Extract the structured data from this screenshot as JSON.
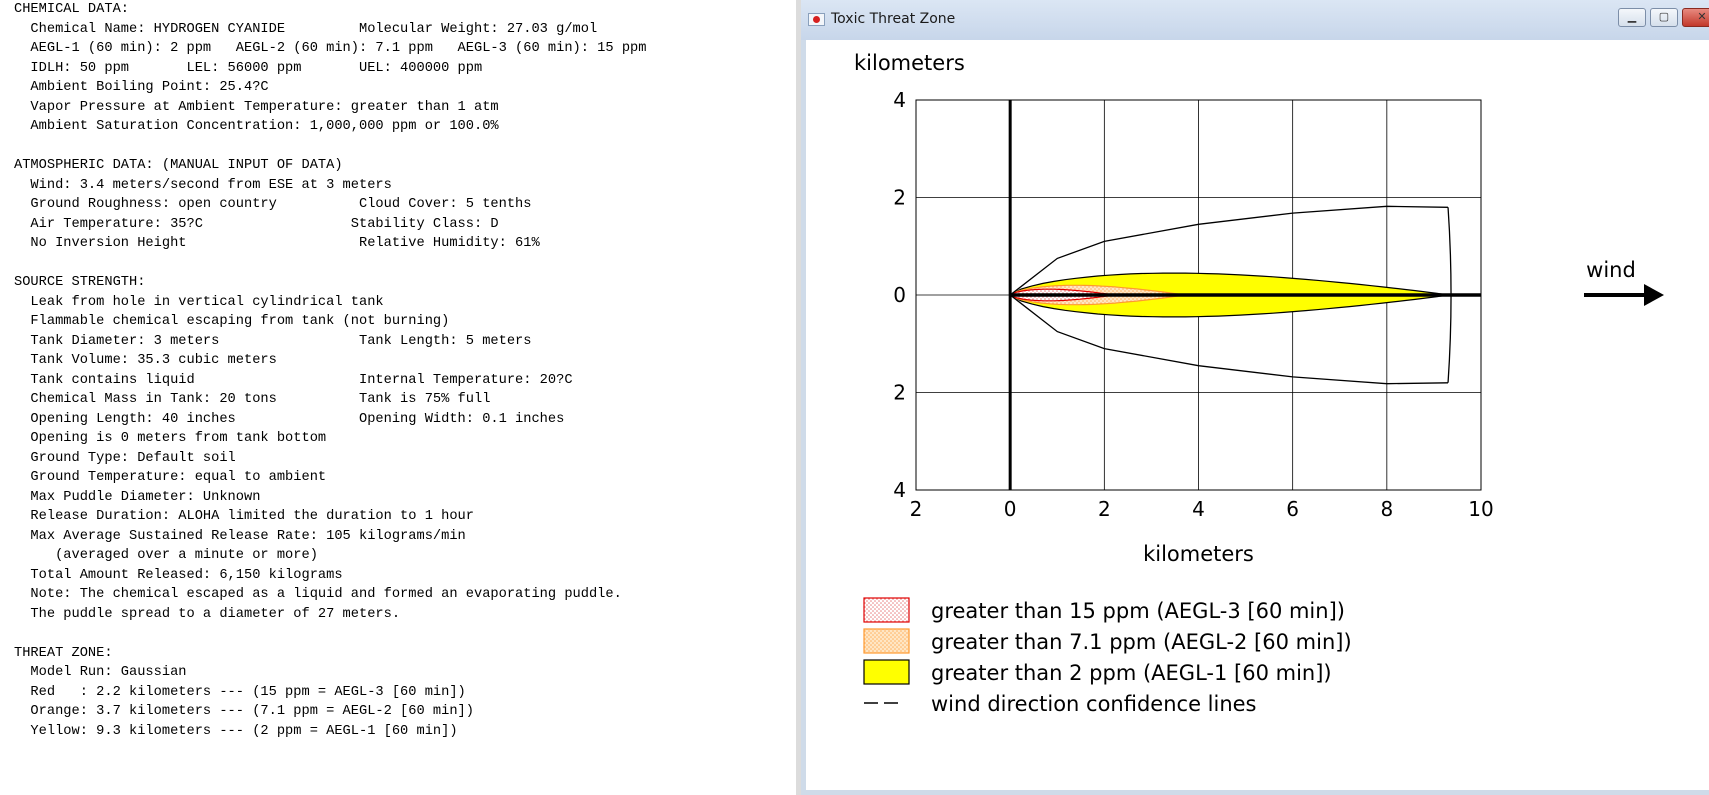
{
  "report": {
    "lines": [
      "CHEMICAL DATA:",
      "  Chemical Name: HYDROGEN CYANIDE         Molecular Weight: 27.03 g/mol",
      "  AEGL-1 (60 min): 2 ppm   AEGL-2 (60 min): 7.1 ppm   AEGL-3 (60 min): 15 ppm",
      "  IDLH: 50 ppm       LEL: 56000 ppm       UEL: 400000 ppm",
      "  Ambient Boiling Point: 25.4?C",
      "  Vapor Pressure at Ambient Temperature: greater than 1 atm",
      "  Ambient Saturation Concentration: 1,000,000 ppm or 100.0%",
      "",
      "ATMOSPHERIC DATA: (MANUAL INPUT OF DATA)",
      "  Wind: 3.4 meters/second from ESE at 3 meters",
      "  Ground Roughness: open country          Cloud Cover: 5 tenths",
      "  Air Temperature: 35?C                  Stability Class: D",
      "  No Inversion Height                     Relative Humidity: 61%",
      "",
      "SOURCE STRENGTH:",
      "  Leak from hole in vertical cylindrical tank",
      "  Flammable chemical escaping from tank (not burning)",
      "  Tank Diameter: 3 meters                 Tank Length: 5 meters",
      "  Tank Volume: 35.3 cubic meters",
      "  Tank contains liquid                    Internal Temperature: 20?C",
      "  Chemical Mass in Tank: 20 tons          Tank is 75% full",
      "  Opening Length: 40 inches               Opening Width: 0.1 inches",
      "  Opening is 0 meters from tank bottom",
      "  Ground Type: Default soil",
      "  Ground Temperature: equal to ambient",
      "  Max Puddle Diameter: Unknown",
      "  Release Duration: ALOHA limited the duration to 1 hour",
      "  Max Average Sustained Release Rate: 105 kilograms/min",
      "     (averaged over a minute or more)",
      "  Total Amount Released: 6,150 kilograms",
      "  Note: The chemical escaped as a liquid and formed an evaporating puddle.",
      "  The puddle spread to a diameter of 27 meters.",
      "",
      "THREAT ZONE:",
      "  Model Run: Gaussian",
      "  Red   : 2.2 kilometers --- (15 ppm = AEGL-3 [60 min])",
      "  Orange: 3.7 kilometers --- (7.1 ppm = AEGL-2 [60 min])",
      "  Yellow: 9.3 kilometers --- (2 ppm = AEGL-1 [60 min])"
    ]
  },
  "window": {
    "title": "Toxic Threat Zone",
    "icon": "aloha-app-icon",
    "controls": [
      "minimize",
      "maximize",
      "close"
    ]
  },
  "chart_data": {
    "type": "area",
    "ylabel": "kilometers",
    "xlabel": "kilometers",
    "xlim": [
      -2,
      10
    ],
    "ylim": [
      -4,
      4
    ],
    "x_tick_labels": [
      "2",
      "0",
      "2",
      "4",
      "6",
      "8",
      "10"
    ],
    "y_tick_labels": [
      "4",
      "2",
      "0",
      "2",
      "4"
    ],
    "grid": true,
    "wind_label": "wind",
    "zones": [
      {
        "name": "Yellow",
        "threshold": "2 ppm",
        "distance_km": 9.3,
        "max_half_width_km": 0.45,
        "color": "#ffff00",
        "edge": "#000000",
        "hatched": false
      },
      {
        "name": "Orange",
        "threshold": "7.1 ppm",
        "distance_km": 3.7,
        "max_half_width_km": 0.2,
        "color": "#ffd9a8",
        "edge": "#ff9a30",
        "hatched": true
      },
      {
        "name": "Red",
        "threshold": "15 ppm",
        "distance_km": 2.2,
        "max_half_width_km": 0.12,
        "color": "#ffd0d0",
        "edge": "#e00000",
        "hatched": true
      }
    ],
    "confidence_lines": {
      "points": [
        [
          0,
          0
        ],
        [
          1,
          0.75
        ],
        [
          2,
          1.1
        ],
        [
          4,
          1.45
        ],
        [
          6,
          1.68
        ],
        [
          8,
          1.82
        ],
        [
          9.3,
          1.8
        ]
      ],
      "tip_x": 9.3
    },
    "legend": [
      {
        "label": "greater than 15 ppm (AEGL-3 [60 min])",
        "color": "#ffd0d0",
        "edge": "#e00000",
        "type": "hatch"
      },
      {
        "label": "greater than 7.1 ppm (AEGL-2 [60 min])",
        "color": "#ffd9a8",
        "edge": "#ff9a30",
        "type": "hatch"
      },
      {
        "label": "greater than 2 ppm (AEGL-1 [60 min])",
        "color": "#ffff00",
        "edge": "#000000",
        "type": "solid"
      },
      {
        "label": "wind direction confidence lines",
        "color": "#000000",
        "edge": "#000000",
        "type": "dash"
      }
    ]
  }
}
